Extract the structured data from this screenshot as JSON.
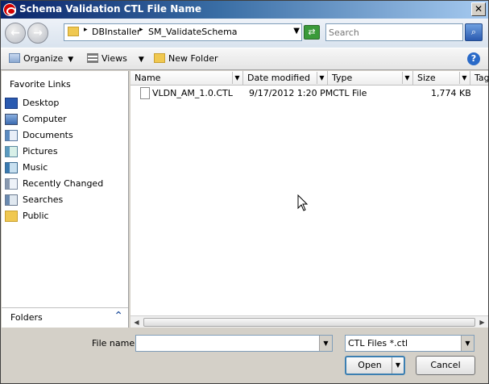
{
  "window": {
    "title": "Schema Validation CTL File Name",
    "close_glyph": "✕"
  },
  "address": {
    "back_glyph": "←",
    "forward_glyph": "→",
    "breadcrumbs": [
      "DBInstaller",
      "SM_ValidateSchema"
    ],
    "search_placeholder": "Search"
  },
  "toolbar": {
    "organize_label": "Organize",
    "views_label": "Views",
    "new_folder_label": "New Folder",
    "help_glyph": "?"
  },
  "sidebar": {
    "header": "Favorite Links",
    "items": [
      {
        "label": "Desktop",
        "icon": "desktop-icon"
      },
      {
        "label": "Computer",
        "icon": "computer-icon"
      },
      {
        "label": "Documents",
        "icon": "documents-icon"
      },
      {
        "label": "Pictures",
        "icon": "pictures-icon"
      },
      {
        "label": "Music",
        "icon": "music-icon"
      },
      {
        "label": "Recently Changed",
        "icon": "recently-changed-icon"
      },
      {
        "label": "Searches",
        "icon": "searches-icon"
      },
      {
        "label": "Public",
        "icon": "public-folder-icon"
      }
    ],
    "folders_label": "Folders"
  },
  "filelist": {
    "columns": [
      "Name",
      "Date modified",
      "Type",
      "Size",
      "Tags"
    ],
    "columns_visible": [
      "Name",
      "Date modified",
      "Type",
      "Size",
      "Tag"
    ],
    "files": [
      {
        "name": "VLDN_AM_1.0.CTL",
        "date_modified": "9/17/2012 1:20 PM",
        "type": "CTL File",
        "size": "1,774 KB"
      }
    ]
  },
  "bottom": {
    "file_name_label": "File name:",
    "file_name_value": "",
    "file_type_value": "CTL Files *.ctl",
    "open_label": "Open",
    "cancel_label": "Cancel"
  },
  "colors": {
    "accent": "#3c7fb1",
    "title_bar": "#0a246a",
    "dialog_bg": "#d4d0c8"
  }
}
